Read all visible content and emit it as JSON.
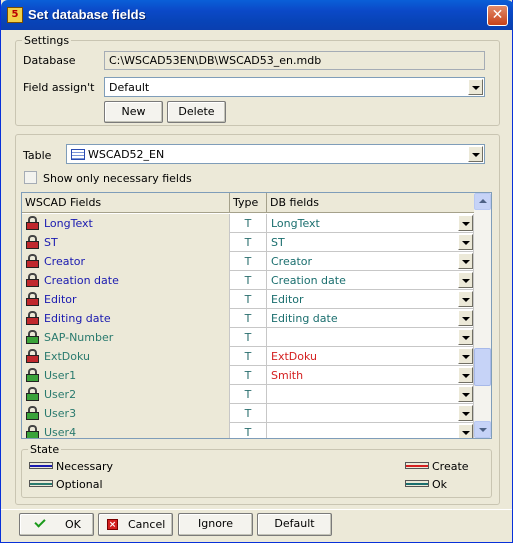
{
  "window": {
    "title": "Set database fields",
    "close_glyph": "✕",
    "app_icon_glyph": "5"
  },
  "settings": {
    "legend": "Settings",
    "database_label": "Database",
    "database_value": "C:\\WSCAD53EN\\DB\\WSCAD53_en.mdb",
    "field_assign_label": "Field assign't",
    "field_assign_value": "Default",
    "new_label": "New",
    "delete_label": "Delete"
  },
  "table_section": {
    "table_label": "Table",
    "table_value": "WSCAD52_EN",
    "show_necessary_label": "Show only necessary fields",
    "show_necessary_checked": false
  },
  "grid": {
    "headers": [
      "WSCAD Fields",
      "Type",
      "DB fields"
    ],
    "rows": [
      {
        "field": "LongText",
        "type": "T",
        "db": "LongText",
        "state": "necessary",
        "lock_color": "#c0282d"
      },
      {
        "field": "ST",
        "type": "T",
        "db": "ST",
        "state": "necessary",
        "lock_color": "#c0282d"
      },
      {
        "field": "Creator",
        "type": "T",
        "db": "Creator",
        "state": "necessary",
        "lock_color": "#c0282d"
      },
      {
        "field": "Creation date",
        "type": "T",
        "db": "Creation date",
        "state": "necessary",
        "lock_color": "#c0282d"
      },
      {
        "field": "Editor",
        "type": "T",
        "db": "Editor",
        "state": "necessary",
        "lock_color": "#c0282d"
      },
      {
        "field": "Editing date",
        "type": "T",
        "db": "Editing date",
        "state": "necessary",
        "lock_color": "#c0282d"
      },
      {
        "field": "SAP-Number",
        "type": "T",
        "db": "",
        "state": "optional",
        "lock_color": "#3aa33a"
      },
      {
        "field": "ExtDoku",
        "type": "T",
        "db": "ExtDoku",
        "state": "optional-create",
        "lock_color": "#c0282d"
      },
      {
        "field": "User1",
        "type": "T",
        "db": "Smith",
        "state": "optional-create",
        "lock_color": "#3aa33a"
      },
      {
        "field": "User2",
        "type": "T",
        "db": "",
        "state": "optional",
        "lock_color": "#3aa33a"
      },
      {
        "field": "User3",
        "type": "T",
        "db": "",
        "state": "optional",
        "lock_color": "#3aa33a"
      },
      {
        "field": "User4",
        "type": "T",
        "db": "",
        "state": "optional",
        "lock_color": "#3aa33a"
      }
    ]
  },
  "state": {
    "legend": "State",
    "necessary_label": "Necessary",
    "optional_label": "Optional",
    "create_label": "Create",
    "ok_label": "Ok",
    "colors": {
      "necessary": "#1a1ab0",
      "optional": "#2a7a6e",
      "create": "#d42020",
      "ok": "#1a6e6e"
    }
  },
  "buttons": {
    "ok": "OK",
    "cancel": "Cancel",
    "ignore": "Ignore",
    "default": "Default"
  },
  "icons": {
    "ok": "check-icon",
    "cancel": "x-icon",
    "table": "table-icon",
    "lock": "lock-icon"
  }
}
